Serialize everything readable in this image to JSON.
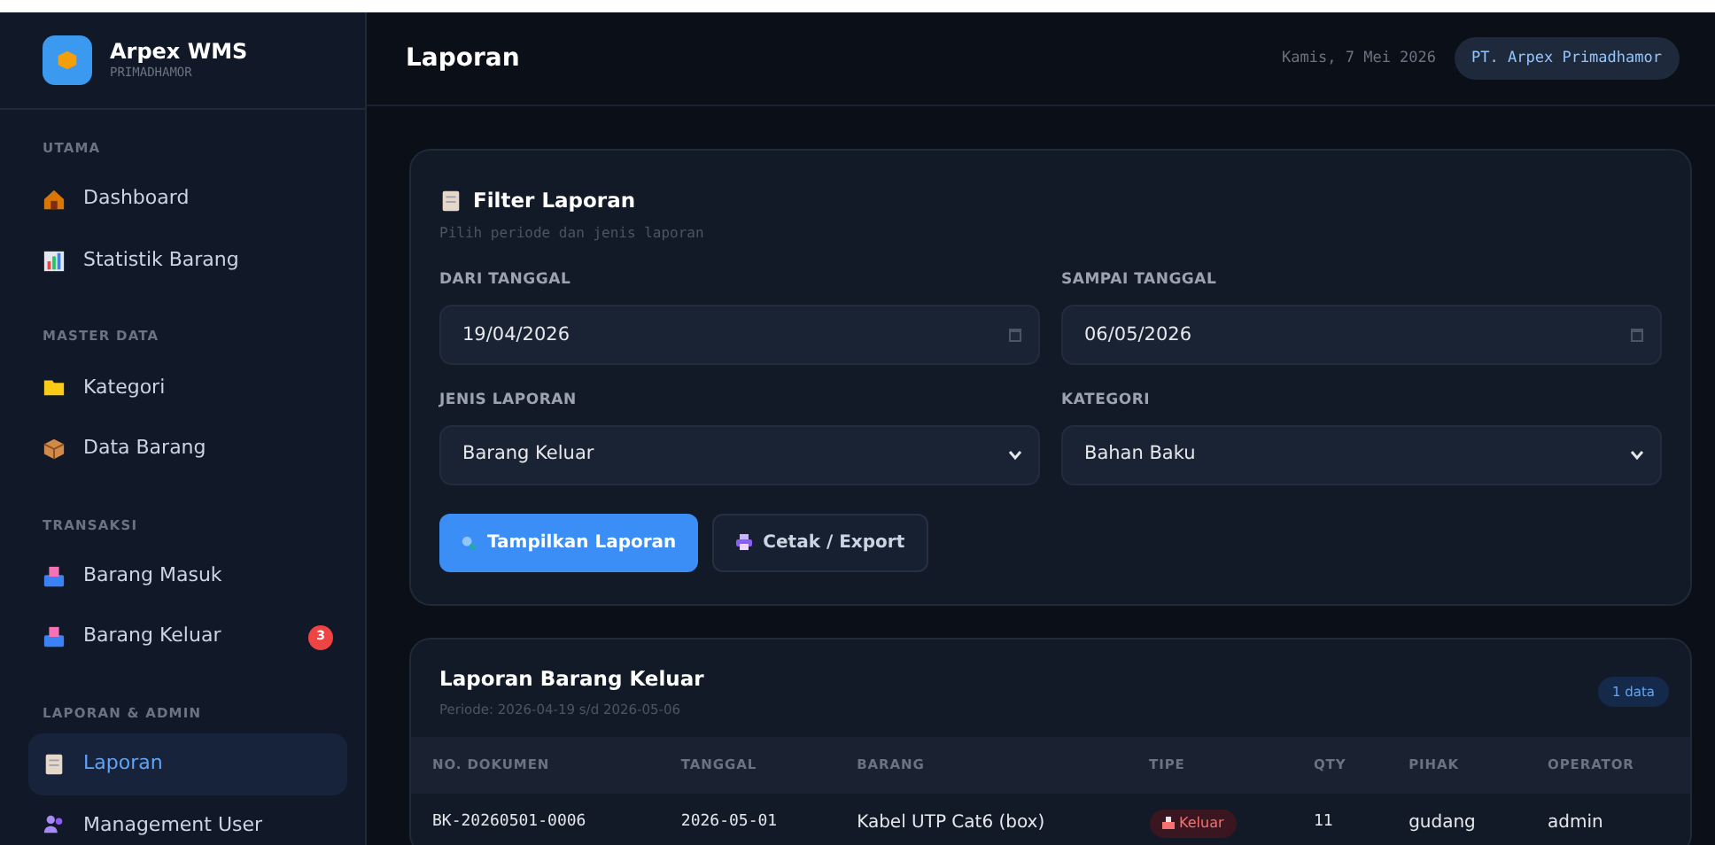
{
  "brand": {
    "name": "Arpex WMS",
    "subtitle": "PRIMADHAMOR"
  },
  "sidebar": {
    "sections": [
      {
        "title": "UTAMA",
        "items": [
          {
            "label": "Dashboard",
            "selected": false
          },
          {
            "label": "Statistik Barang",
            "selected": false
          }
        ]
      },
      {
        "title": "MASTER DATA",
        "items": [
          {
            "label": "Kategori",
            "selected": false
          },
          {
            "label": "Data Barang",
            "selected": false
          }
        ]
      },
      {
        "title": "TRANSAKSI",
        "items": [
          {
            "label": "Barang Masuk",
            "selected": false
          },
          {
            "label": "Barang Keluar",
            "selected": false,
            "badge": "3"
          }
        ]
      },
      {
        "title": "LAPORAN & ADMIN",
        "items": [
          {
            "label": "Laporan",
            "selected": true
          },
          {
            "label": "Management User",
            "selected": false
          }
        ]
      }
    ]
  },
  "header": {
    "title": "Laporan",
    "date": "Kamis, 7 Mei 2026",
    "company": "PT. Arpex Primadhamor"
  },
  "filter": {
    "title": "Filter Laporan",
    "subtitle": "Pilih periode dan jenis laporan",
    "fields": [
      {
        "label": "DARI TANGGAL",
        "kind": "date",
        "value": "19/04/2026"
      },
      {
        "label": "SAMPAI TANGGAL",
        "kind": "date",
        "value": "06/05/2026"
      },
      {
        "label": "JENIS LAPORAN",
        "kind": "select",
        "value": "Barang Keluar"
      },
      {
        "label": "KATEGORI",
        "kind": "select",
        "value": "Bahan Baku"
      }
    ],
    "buttons": [
      {
        "label": "Tampilkan Laporan",
        "kind": "primary"
      },
      {
        "label": "Cetak / Export",
        "kind": "secondary"
      }
    ]
  },
  "report": {
    "title": "Laporan Barang Keluar",
    "period": "Periode: 2026-04-19 s/d 2026-05-06",
    "count": "1 data",
    "columns": [
      "NO. DOKUMEN",
      "TANGGAL",
      "BARANG",
      "TIPE",
      "QTY",
      "PIHAK",
      "OPERATOR"
    ],
    "rows": [
      {
        "no": "BK-20260501-0006",
        "tanggal": "2026-05-01",
        "barang": "Kabel UTP Cat6 (box)",
        "tipe": "Keluar",
        "kind": "out",
        "qty": "11",
        "pihak": "gudang",
        "operator": "admin"
      }
    ]
  }
}
